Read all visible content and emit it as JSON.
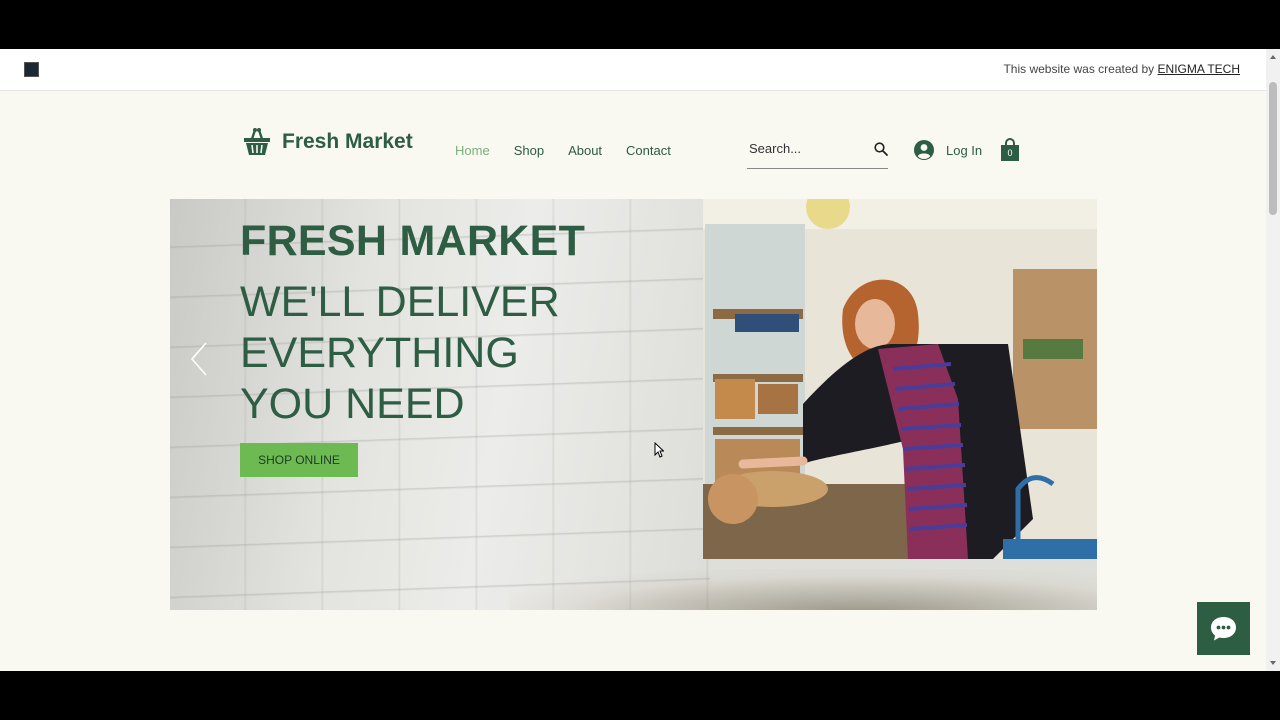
{
  "credit": {
    "text": "This website was created by",
    "link": "ENIGMA TECH"
  },
  "header": {
    "brand": "Fresh Market",
    "nav": [
      {
        "label": "Home",
        "active": true
      },
      {
        "label": "Shop",
        "active": false
      },
      {
        "label": "About",
        "active": false
      },
      {
        "label": "Contact",
        "active": false
      }
    ],
    "search_placeholder": "Search...",
    "login_label": "Log In",
    "cart_count": "0"
  },
  "hero": {
    "title": "FRESH MARKET",
    "tagline_lines": [
      "WE'LL DELIVER",
      "EVERYTHING",
      "YOU NEED"
    ],
    "cta_label": "SHOP ONLINE"
  },
  "colors": {
    "brand_green": "#2d5d42",
    "accent_green": "#6dba52",
    "nav_active": "#7bb07b",
    "page_bg": "#f9f8f1"
  },
  "icons": [
    "basket-icon",
    "search-icon",
    "user-avatar-icon",
    "shopping-bag-icon",
    "chevron-left-icon",
    "chat-icon",
    "mouse-cursor-icon"
  ]
}
